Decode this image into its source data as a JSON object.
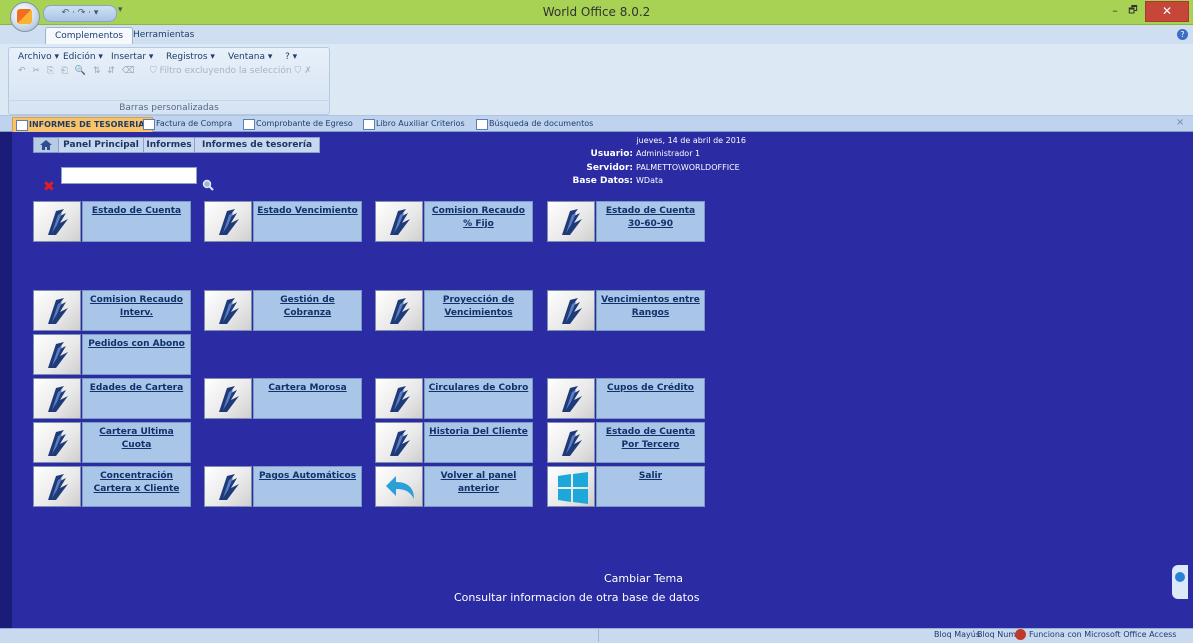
{
  "window": {
    "title": "World Office 8.0.2",
    "qat_text": "↶ · ↷ · ▾",
    "qat_arrow": "▾",
    "minimize_glyph": "–",
    "maximize_glyph": "🗗",
    "close_glyph": "✕"
  },
  "ribbon": {
    "tabs": [
      "Complementos",
      "Herramientas"
    ],
    "menus": [
      "Archivo ▾",
      "Edición ▾",
      "Insertar ▾",
      "Registros ▾",
      "Ventana ▾",
      "? ▾"
    ],
    "filter_label": "Filtro excluyendo la selección",
    "group_label": "Barras personalizadas",
    "help_glyph": "?"
  },
  "doc_tabs": [
    "INFORMES DE TESORERIA",
    "Factura de Compra",
    "Comprobante de Egreso",
    "Libro Auxiliar Criterios",
    "Búsqueda de documentos"
  ],
  "breadcrumb": [
    "Panel Principal",
    "Informes",
    "Informes de tesorería"
  ],
  "session": {
    "date": "jueves, 14 de abril de 2016",
    "usuario_label": "Usuario:",
    "usuario": "Administrador 1",
    "servidor_label": "Servidor:",
    "servidor": "PALMETTO\\WORLDOFFICE",
    "base_label": "Base Datos:",
    "base": "WData"
  },
  "search": {
    "value": "",
    "placeholder": ""
  },
  "reports": [
    "Estado de Cuenta",
    "Estado Vencimiento",
    "Comision Recaudo % Fijo",
    "Estado de Cuenta 30-60-90",
    "Comision Recaudo Interv.",
    "Gestión de Cobranza",
    "Proyección de Vencimientos",
    "Vencimientos entre Rangos",
    "Pedidos con Abono",
    "Edades de Cartera",
    "Cartera Morosa",
    "Circulares de Cobro",
    "Cupos de Crédito",
    "Cartera Ultima Cuota",
    "Historia Del Cliente",
    "Estado de Cuenta Por Tercero",
    "Concentración Cartera x Cliente",
    "Pagos Automáticos",
    "Volver al panel anterior",
    "Salir"
  ],
  "footer": {
    "cambiar_tema": "Cambiar Tema",
    "consultar": "Consultar informacion de otra base de datos"
  },
  "status": {
    "bloq_mayus": "Bloq Mayús",
    "bloq_num": "Bloq Num",
    "access": "Funciona con Microsoft Office Access"
  }
}
